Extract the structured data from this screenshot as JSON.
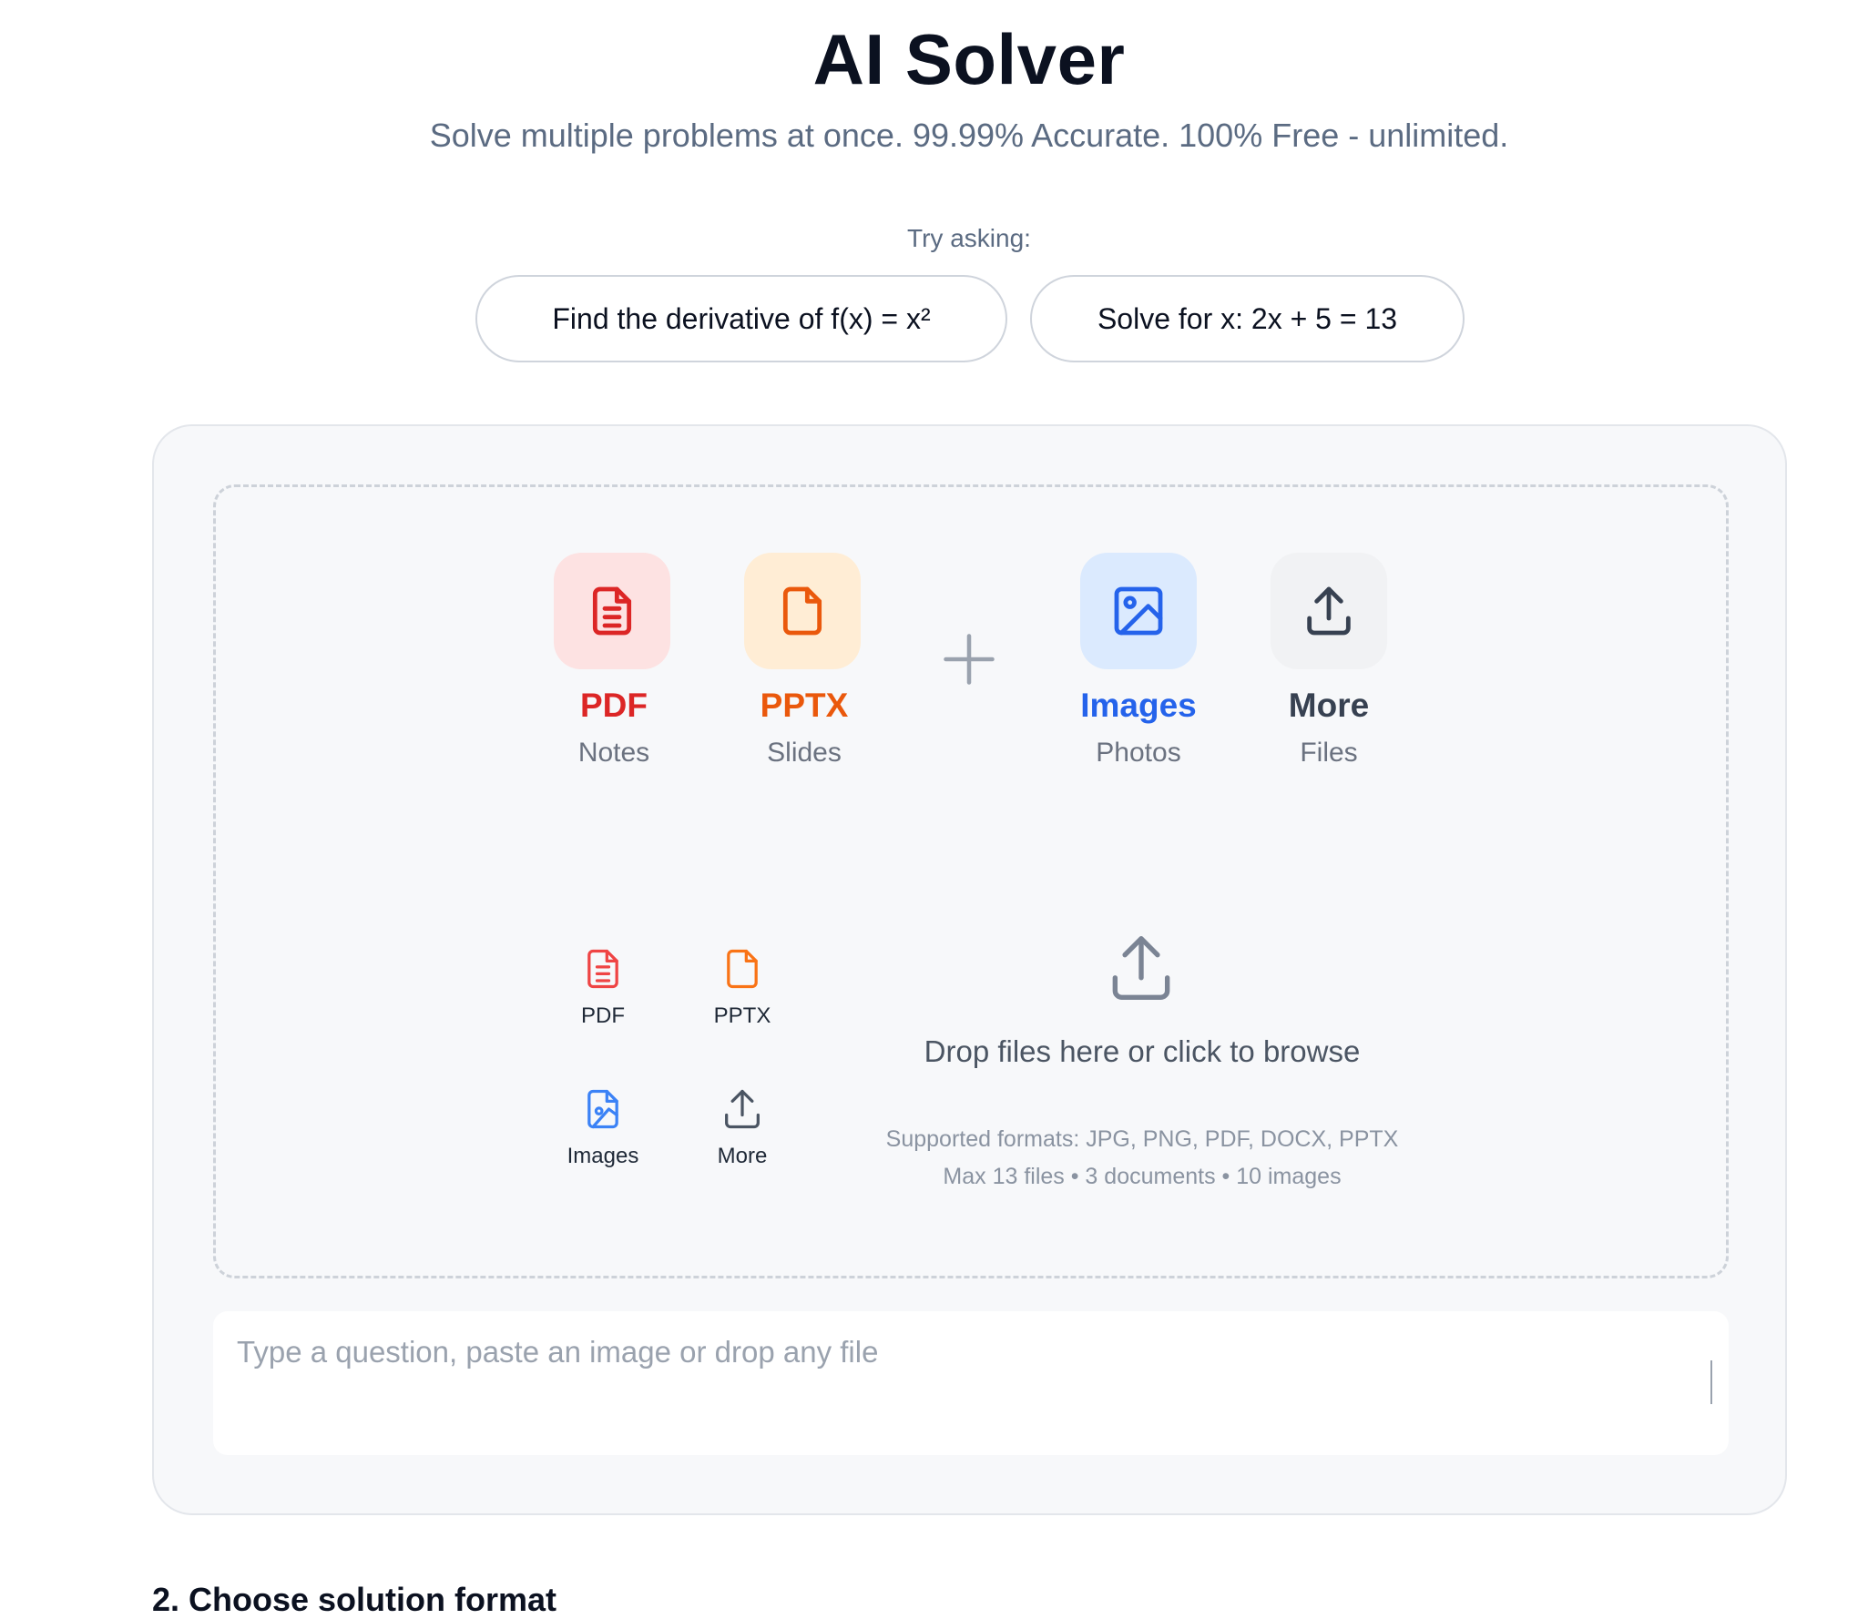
{
  "header": {
    "title": "AI Solver",
    "subtitle": "Solve multiple problems at once. 99.99% Accurate. 100% Free - unlimited."
  },
  "suggestions": {
    "label": "Try asking:",
    "items": [
      "Find the derivative of f(x) = x²",
      "Solve for x: 2x + 5 = 13"
    ]
  },
  "upload_types": [
    {
      "label": "PDF",
      "sub": "Notes",
      "color": "#dc2626",
      "bg": "#fde2e2",
      "icon": "pdf-file-icon"
    },
    {
      "label": "PPTX",
      "sub": "Slides",
      "color": "#ea580c",
      "bg": "#ffedd5",
      "icon": "pptx-file-icon"
    },
    {
      "label": "Images",
      "sub": "Photos",
      "color": "#2563eb",
      "bg": "#dbeafe",
      "icon": "image-icon"
    },
    {
      "label": "More",
      "sub": "Files",
      "color": "#374151",
      "bg": "#f1f2f4",
      "icon": "upload-icon"
    }
  ],
  "mini_types": [
    "PDF",
    "PPTX",
    "Images",
    "More"
  ],
  "dropzone": {
    "text": "Drop files here or click to browse",
    "formats": "Supported formats: JPG, PNG, PDF, DOCX, PPTX",
    "limits": "Max 13 files • 3 documents • 10 images"
  },
  "input": {
    "placeholder": "Type a question, paste an image or drop any file",
    "value": ""
  },
  "next_section": {
    "heading": "2. Choose solution format"
  }
}
